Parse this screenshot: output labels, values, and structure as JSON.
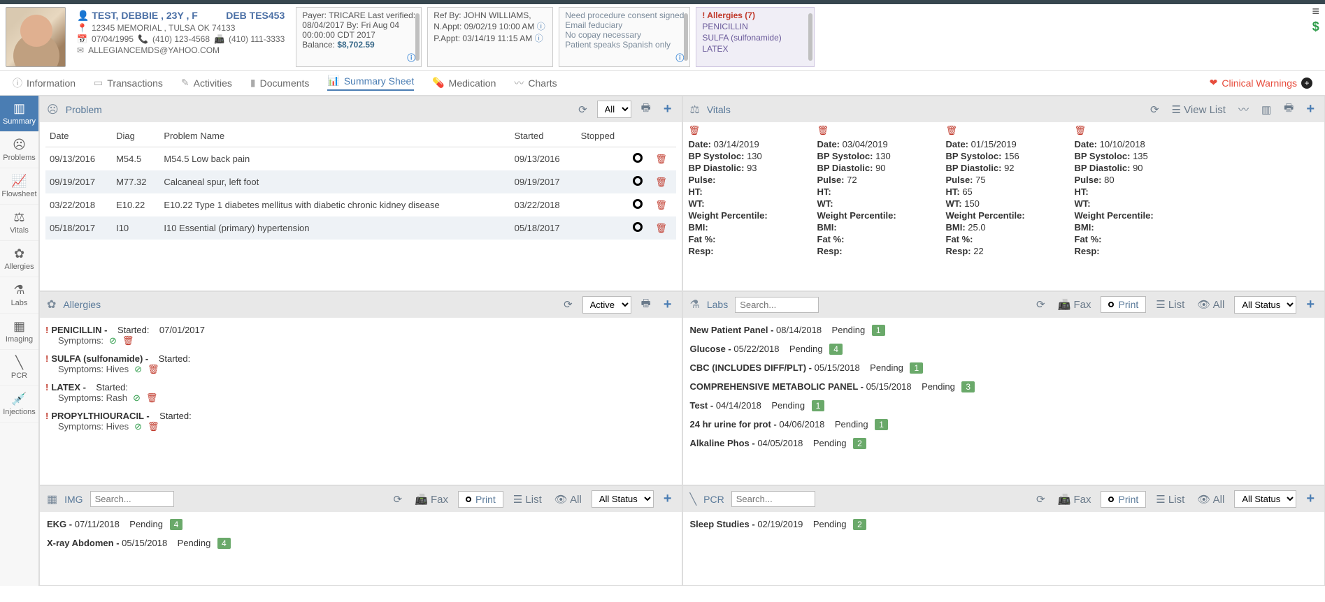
{
  "patient": {
    "name": "TEST, DEBBIE , 23Y , F",
    "mrn": "DEB TES453",
    "address": "12345 MEMORIAL , TULSA OK 74133",
    "dob": "07/04/1995",
    "phone1": "(410) 123-4568",
    "phone2": "(410) 111-3333",
    "email": "ALLEGIANCEMDS@YAHOO.COM"
  },
  "payer": {
    "line1": "Payer: TRICARE Last verified:",
    "line2": "08/04/2017 By: Fri Aug 04",
    "line3": "00:00:00 CDT 2017",
    "balance_lbl": "Balance:",
    "balance": "$8,702.59"
  },
  "ref": {
    "by": "Ref By: JOHN WILLIAMS,",
    "next": "N.Appt: 09/02/19 10:00 AM",
    "prev": "P.Appt: 03/14/19 11:15 AM"
  },
  "notes": {
    "n1": "Need procedure consent signed",
    "n2": "Email feduciary",
    "n3": "No copay necessary",
    "n4": "Patient speaks Spanish only"
  },
  "allergy_card": {
    "hd": "! Allergies (7)",
    "a1": "PENICILLIN",
    "a2": "SULFA (sulfonamide)",
    "a3": "LATEX"
  },
  "tabs": {
    "info": "Information",
    "trans": "Transactions",
    "act": "Activities",
    "docs": "Documents",
    "summary": "Summary Sheet",
    "med": "Medication",
    "charts": "Charts",
    "clin": "Clinical Warnings"
  },
  "side": {
    "summary": "Summary",
    "problems": "Problems",
    "flow": "Flowsheet",
    "vitals": "Vitals",
    "allergies": "Allergies",
    "labs": "Labs",
    "imaging": "Imaging",
    "pcr": "PCR",
    "inj": "Injections"
  },
  "problem_panel": {
    "title": "Problem",
    "filter": "All",
    "cols": {
      "date": "Date",
      "diag": "Diag",
      "name": "Problem Name",
      "started": "Started",
      "stopped": "Stopped"
    },
    "rows": [
      {
        "date": "09/13/2016",
        "diag": "M54.5",
        "name": "M54.5 Low back pain",
        "started": "09/13/2016"
      },
      {
        "date": "09/19/2017",
        "diag": "M77.32",
        "name": "Calcaneal spur, left foot",
        "started": "09/19/2017"
      },
      {
        "date": "03/22/2018",
        "diag": "E10.22",
        "name": "E10.22 Type 1 diabetes mellitus with diabetic chronic kidney disease",
        "started": "03/22/2018"
      },
      {
        "date": "05/18/2017",
        "diag": "I10",
        "name": "I10 Essential (primary) hypertension",
        "started": "05/18/2017"
      }
    ]
  },
  "vitals_panel": {
    "title": "Vitals",
    "viewlist": "View List",
    "labels": {
      "date": "Date:",
      "sys": "BP Systoloc:",
      "dia": "BP Diastolic:",
      "pulse": "Pulse:",
      "ht": "HT:",
      "wt": "WT:",
      "wp": "Weight Percentile:",
      "bmi": "BMI:",
      "fat": "Fat %:",
      "resp": "Resp:"
    },
    "cols": [
      {
        "date": "03/14/2019",
        "sys": "130",
        "dia": "93",
        "pulse": "",
        "ht": "",
        "wt": "",
        "wp": "",
        "bmi": "",
        "fat": "",
        "resp": ""
      },
      {
        "date": "03/04/2019",
        "sys": "130",
        "dia": "90",
        "pulse": "72",
        "ht": "",
        "wt": "",
        "wp": "",
        "bmi": "",
        "fat": "",
        "resp": ""
      },
      {
        "date": "01/15/2019",
        "sys": "156",
        "dia": "92",
        "pulse": "75",
        "ht": "65",
        "wt": "150",
        "wp": "",
        "bmi": "25.0",
        "fat": "",
        "resp": "22"
      },
      {
        "date": "10/10/2018",
        "sys": "135",
        "dia": "90",
        "pulse": "80",
        "ht": "",
        "wt": "",
        "wp": "",
        "bmi": "",
        "fat": "",
        "resp": ""
      }
    ]
  },
  "allergies_panel": {
    "title": "Allergies",
    "filter": "Active",
    "rows": [
      {
        "name": "PENICILLIN -",
        "started": "Started:",
        "date": "07/01/2017",
        "sym": "Symptoms:"
      },
      {
        "name": "SULFA (sulfonamide) -",
        "started": "Started:",
        "date": "",
        "sym": "Symptoms: Hives"
      },
      {
        "name": "LATEX -",
        "started": "Started:",
        "date": "",
        "sym": "Symptoms: Rash"
      },
      {
        "name": "PROPYLTHIOURACIL -",
        "started": "Started:",
        "date": "",
        "sym": "Symptoms: Hives"
      }
    ]
  },
  "labs_panel": {
    "title": "Labs",
    "search_ph": "Search...",
    "fax": "Fax",
    "print": "Print",
    "list": "List",
    "all": "All",
    "status": "All Status",
    "rows": [
      {
        "nm": "New Patient Panel -",
        "dt": "08/14/2018",
        "st": "Pending",
        "b": "1"
      },
      {
        "nm": "Glucose -",
        "dt": "05/22/2018",
        "st": "Pending",
        "b": "4"
      },
      {
        "nm": "CBC (INCLUDES DIFF/PLT) -",
        "dt": "05/15/2018",
        "st": "Pending",
        "b": "1"
      },
      {
        "nm": "COMPREHENSIVE METABOLIC PANEL -",
        "dt": "05/15/2018",
        "st": "Pending",
        "b": "3"
      },
      {
        "nm": "Test -",
        "dt": "04/14/2018",
        "st": "Pending",
        "b": "1"
      },
      {
        "nm": "24 hr urine for prot -",
        "dt": "04/06/2018",
        "st": "Pending",
        "b": "1"
      },
      {
        "nm": "Alkaline Phos -",
        "dt": "04/05/2018",
        "st": "Pending",
        "b": "2"
      }
    ]
  },
  "img_panel": {
    "title": "IMG",
    "search_ph": "Search...",
    "fax": "Fax",
    "print": "Print",
    "list": "List",
    "all": "All",
    "status": "All Status",
    "rows": [
      {
        "nm": "EKG -",
        "dt": "07/11/2018",
        "st": "Pending",
        "b": "4"
      },
      {
        "nm": "X-ray Abdomen -",
        "dt": "05/15/2018",
        "st": "Pending",
        "b": "4"
      }
    ]
  },
  "pcr_panel": {
    "title": "PCR",
    "search_ph": "Search...",
    "fax": "Fax",
    "print": "Print",
    "list": "List",
    "all": "All",
    "status": "All Status",
    "rows": [
      {
        "nm": "Sleep Studies -",
        "dt": "02/19/2019",
        "st": "Pending",
        "b": "2"
      }
    ]
  }
}
